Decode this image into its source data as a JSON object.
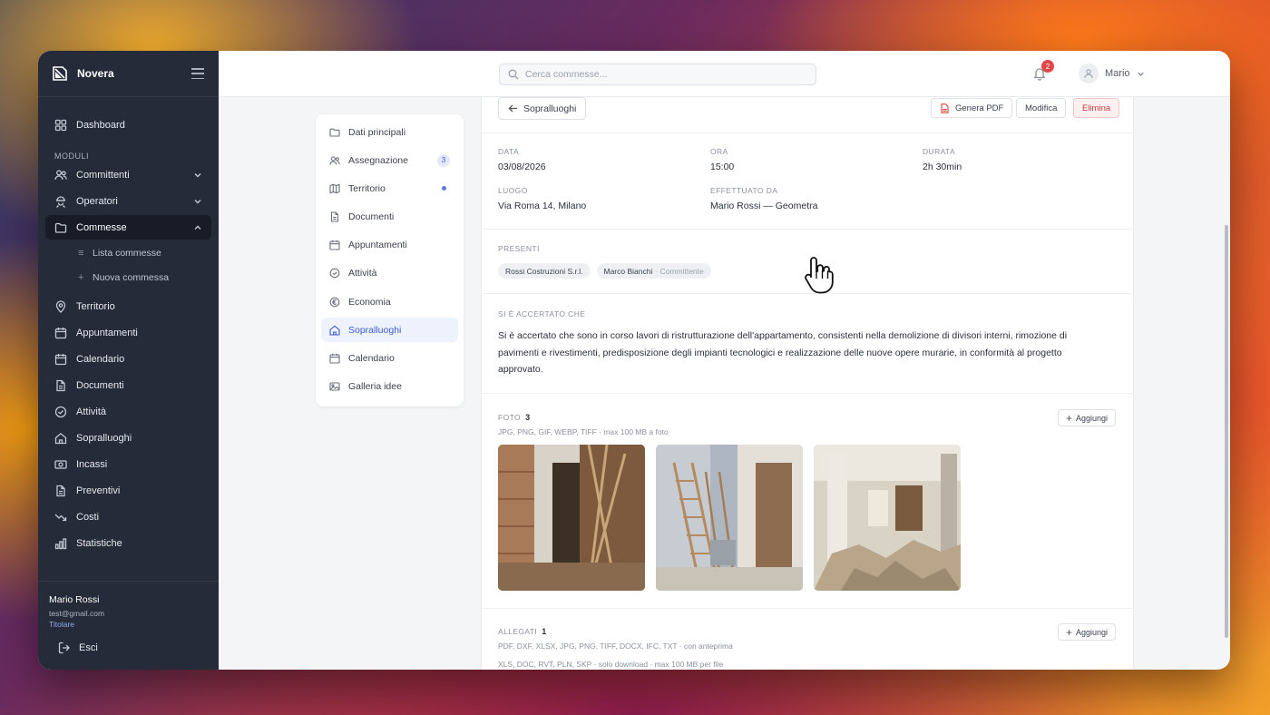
{
  "app": {
    "name": "Novera"
  },
  "sidebar": {
    "dashboard": "Dashboard",
    "section_label": "MODULI",
    "items": [
      {
        "label": "Committenti"
      },
      {
        "label": "Operatori"
      },
      {
        "label": "Commesse"
      },
      {
        "label": "Territorio"
      },
      {
        "label": "Appuntamenti"
      },
      {
        "label": "Calendario"
      },
      {
        "label": "Documenti"
      },
      {
        "label": "Attività"
      },
      {
        "label": "Sopralluoghi"
      },
      {
        "label": "Incassi"
      },
      {
        "label": "Preventivi"
      },
      {
        "label": "Costi"
      },
      {
        "label": "Statistiche"
      }
    ],
    "sub_items": [
      {
        "label": "Lista commesse"
      },
      {
        "label": "Nuova commessa"
      }
    ],
    "user": {
      "name": "Mario Rossi",
      "email": "test@gmail.com",
      "role": "Titolare"
    },
    "logout": "Esci"
  },
  "topbar": {
    "search_placeholder": "Cerca commesse...",
    "notifications_count": "2",
    "user_name": "Mario"
  },
  "subnav": {
    "items": [
      {
        "label": "Dati principali"
      },
      {
        "label": "Assegnazione",
        "count": "3"
      },
      {
        "label": "Territorio"
      },
      {
        "label": "Documenti"
      },
      {
        "label": "Appuntamenti"
      },
      {
        "label": "Attività"
      },
      {
        "label": "Economia"
      },
      {
        "label": "Sopralluoghi"
      },
      {
        "label": "Calendario"
      },
      {
        "label": "Galleria idee"
      }
    ]
  },
  "detail": {
    "back_label": "Sopralluoghi",
    "pdf_label": "Genera PDF",
    "edit_label": "Modifica",
    "delete_label": "Elimina",
    "fields": {
      "data_label": "DATA",
      "data_value": "03/08/2026",
      "ora_label": "ORA",
      "ora_value": "15:00",
      "durata_label": "DURATA",
      "durata_value": "2h 30min",
      "luogo_label": "LUOGO",
      "luogo_value": "Via Roma 14, Milano",
      "effettuato_label": "EFFETTUATO DA",
      "effettuato_value": "Mario Rossi — Geometra"
    },
    "presenti_label": "PRESENTI",
    "presenti": [
      {
        "name": "Rossi Costruzioni S.r.l.",
        "role": ""
      },
      {
        "name": "Marco Bianchi",
        "role": "· Committente"
      }
    ],
    "accertato_label": "SI È ACCERTATO CHE",
    "accertato_text": "Si è accertato che sono in corso lavori di ristrutturazione dell'appartamento, consistenti nella demolizione di divisori interni, rimozione di pavimenti e rivestimenti, predisposizione degli impianti tecnologici e realizzazione delle nuove opere murarie, in conformità al progetto approvato.",
    "foto_label": "FOTO",
    "foto_count": "3",
    "foto_hint": "JPG, PNG, GIF, WEBP, TIFF · max 100 MB a foto",
    "add_label": "Aggiungi",
    "allegati_label": "ALLEGATI",
    "allegati_count": "1",
    "allegati_hint": "PDF, DXF, XLSX, JPG, PNG, TIFF, DOCX, IFC, TXT · con anteprima",
    "allegati_hint2": "XLS, DOC, RVT, PLN, SKP · solo download · max 100 MB per file"
  },
  "colors": {
    "sidebar_bg": "#252b38",
    "accent": "#3b5bcf",
    "danger": "#c83a3a",
    "badge": "#e04848"
  }
}
